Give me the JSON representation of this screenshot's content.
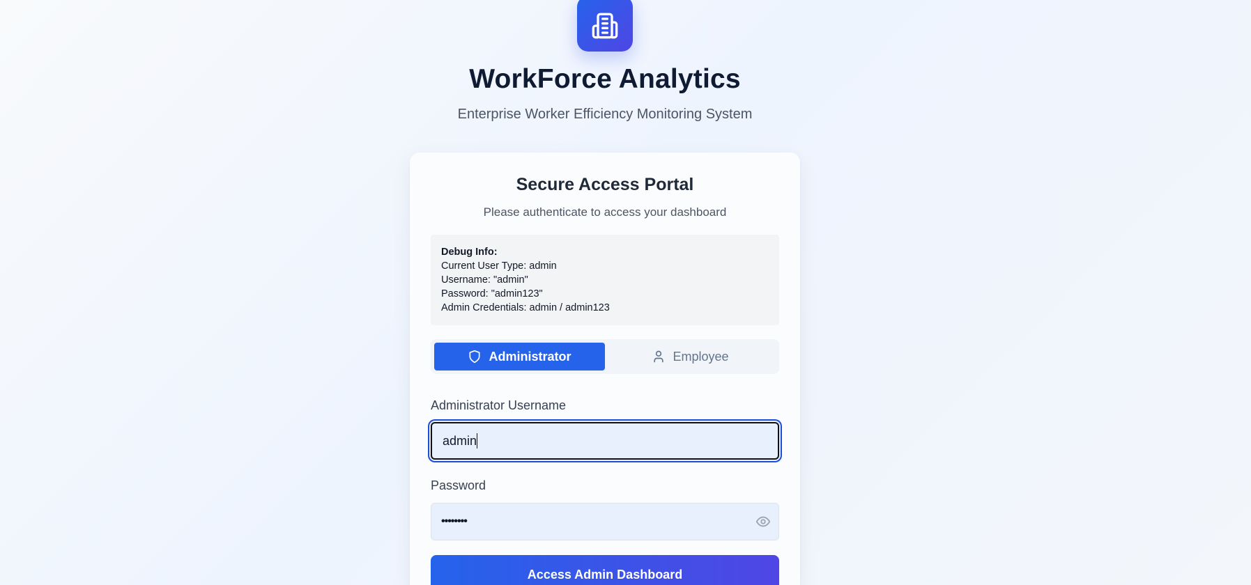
{
  "header": {
    "logo_icon": "building-icon",
    "title": "WorkForce Analytics",
    "subtitle": "Enterprise Worker Efficiency Monitoring System"
  },
  "card": {
    "title": "Secure Access Portal",
    "subtitle": "Please authenticate to access your dashboard"
  },
  "debug": {
    "heading": "Debug Info:",
    "lines": [
      "Current User Type: admin",
      "Username: \"admin\"",
      "Password: \"admin123\"",
      "Admin Credentials: admin / admin123"
    ]
  },
  "role_toggle": {
    "tabs": [
      {
        "label": "Administrator",
        "icon": "shield-icon",
        "active": true
      },
      {
        "label": "Employee",
        "icon": "user-icon",
        "active": false
      }
    ]
  },
  "form": {
    "username_label": "Administrator Username",
    "username_value": "admin",
    "password_label": "Password",
    "password_masked": "••••••••",
    "toggle_visibility_icon": "eye-icon",
    "submit_label": "Access Admin Dashboard"
  },
  "colors": {
    "accent": "#2563eb",
    "accent_secondary": "#4f46e5",
    "input_bg": "#e8f0fe"
  }
}
